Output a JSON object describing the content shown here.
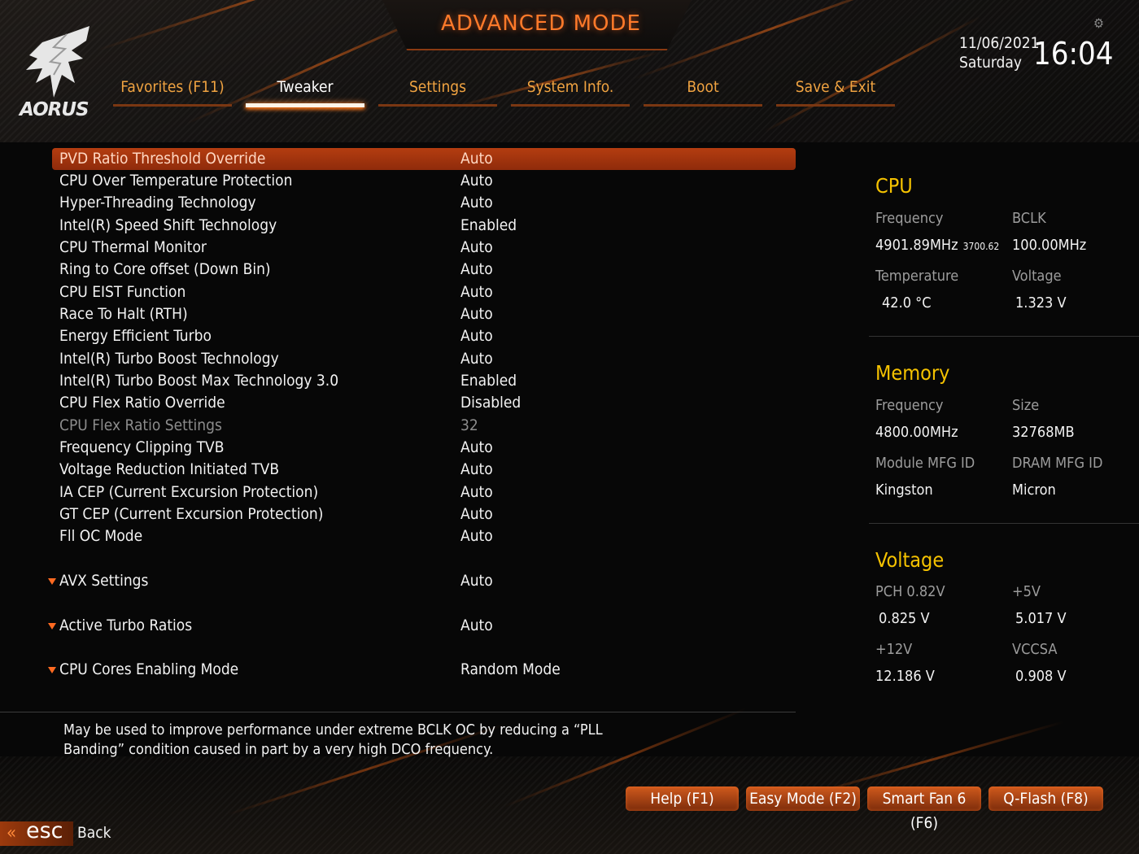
{
  "header": {
    "title": "ADVANCED MODE",
    "logo_text": "AORUS",
    "date": "11/06/2021",
    "day": "Saturday",
    "time": "16:04"
  },
  "tabs": [
    {
      "label": "Favorites (F11)",
      "active": false
    },
    {
      "label": "Tweaker",
      "active": true
    },
    {
      "label": "Settings",
      "active": false
    },
    {
      "label": "System Info.",
      "active": false
    },
    {
      "label": "Boot",
      "active": false
    },
    {
      "label": "Save & Exit",
      "active": false
    }
  ],
  "settings": [
    {
      "label": "PVD Ratio Threshold Override",
      "value": "Auto",
      "selected": true
    },
    {
      "label": "CPU Over Temperature Protection",
      "value": "Auto"
    },
    {
      "label": "Hyper-Threading Technology",
      "value": "Auto"
    },
    {
      "label": "Intel(R) Speed Shift Technology",
      "value": "Enabled"
    },
    {
      "label": "CPU Thermal Monitor",
      "value": "Auto"
    },
    {
      "label": "Ring to Core offset (Down Bin)",
      "value": "Auto"
    },
    {
      "label": "CPU EIST Function",
      "value": "Auto"
    },
    {
      "label": "Race To Halt (RTH)",
      "value": "Auto"
    },
    {
      "label": "Energy Efficient Turbo",
      "value": "Auto"
    },
    {
      "label": "Intel(R) Turbo Boost Technology",
      "value": "Auto"
    },
    {
      "label": "Intel(R) Turbo Boost Max Technology 3.0",
      "value": "Enabled"
    },
    {
      "label": "CPU Flex Ratio Override",
      "value": "Disabled"
    },
    {
      "label": "CPU Flex Ratio Settings",
      "value": "32",
      "disabled": true
    },
    {
      "label": "Frequency Clipping TVB",
      "value": "Auto"
    },
    {
      "label": "Voltage Reduction Initiated TVB",
      "value": "Auto"
    },
    {
      "label": "IA CEP (Current Excursion Protection)",
      "value": "Auto"
    },
    {
      "label": "GT CEP (Current Excursion Protection)",
      "value": "Auto"
    },
    {
      "label": "Fll OC Mode",
      "value": "Auto"
    }
  ],
  "submenus": [
    {
      "label": "AVX Settings",
      "value": "Auto"
    },
    {
      "label": "Active Turbo Ratios",
      "value": "Auto"
    },
    {
      "label": "CPU Cores Enabling Mode",
      "value": "Random Mode"
    }
  ],
  "description": "May be used to improve performance under extreme BCLK OC by reducing a “PLL Banding” condition caused in part by a very high DCO frequency.",
  "cpu": {
    "title": "CPU",
    "frequency_label": "Frequency",
    "frequency_value": "4901.89MHz",
    "frequency_small": "3700.62",
    "bclk_label": "BCLK",
    "bclk_value": "100.00MHz",
    "temperature_label": "Temperature",
    "temperature_value": "42.0 °C",
    "voltage_label": "Voltage",
    "voltage_value": "1.323 V"
  },
  "memory": {
    "title": "Memory",
    "frequency_label": "Frequency",
    "frequency_value": "4800.00MHz",
    "size_label": "Size",
    "size_value": "32768MB",
    "module_label": "Module MFG ID",
    "module_value": "Kingston",
    "dram_label": "DRAM MFG ID",
    "dram_value": "Micron"
  },
  "voltage": {
    "title": "Voltage",
    "pch_label": "PCH 0.82V",
    "pch_value": "0.825 V",
    "v5_label": "+5V",
    "v5_value": "5.017 V",
    "v12_label": "+12V",
    "v12_value": "12.186 V",
    "vccsa_label": "VCCSA",
    "vccsa_value": "0.908 V"
  },
  "buttons": {
    "help": "Help (F1)",
    "easy": "Easy Mode (F2)",
    "fan": "Smart Fan 6 (F6)",
    "qflash": "Q-Flash (F8)"
  },
  "footer": {
    "esc_label": "esc",
    "back_label": "Back"
  },
  "colors": {
    "accent_orange": "#f0a341",
    "highlight": "#b43d10",
    "section_title": "#f5c200"
  },
  "icons": [
    "aorus-eagle-logo",
    "gear-icon",
    "submenu-arrow-icon",
    "esc-chevron-icon"
  ]
}
